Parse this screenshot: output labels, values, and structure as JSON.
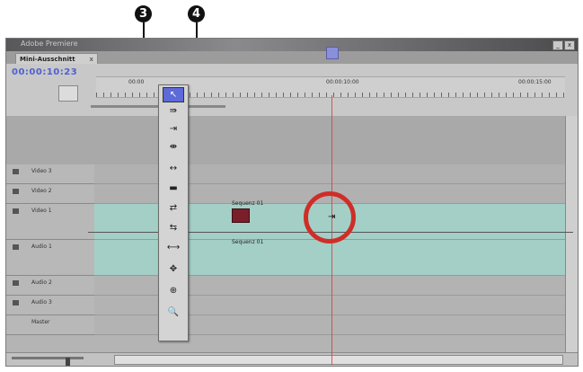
{
  "callouts": [
    "3",
    "4"
  ],
  "window": {
    "title": "Adobe Premiere",
    "minimize": "_",
    "close": "x"
  },
  "tabs": [
    {
      "label": "Mini-Ausschnitt",
      "close": "x"
    }
  ],
  "header": {
    "timecode": "00:00:10:23"
  },
  "ruler": {
    "ticks": [
      "00:00",
      "00:00:10:00",
      "00:00:15:00"
    ]
  },
  "tracks": [
    {
      "name": "Video 3",
      "kind": "video"
    },
    {
      "name": "Video 2",
      "kind": "video"
    },
    {
      "name": "Video 1",
      "kind": "teal"
    },
    {
      "name": "Audio 1",
      "kind": "teal"
    },
    {
      "name": "Audio 2",
      "kind": "audio"
    },
    {
      "name": "Audio 3",
      "kind": "audio"
    },
    {
      "name": "Master",
      "kind": "audio"
    }
  ],
  "clips": {
    "video_label": "Sequenz 01",
    "audio_label": "Sequenz 01"
  },
  "tools": [
    {
      "name": "select-tool",
      "glyph": "↖",
      "active": true
    },
    {
      "name": "track-select-tool",
      "glyph": "⇛"
    },
    {
      "name": "ripple-edit-tool",
      "glyph": "⇥"
    },
    {
      "name": "rolling-edit-tool",
      "glyph": "⇼"
    },
    {
      "name": "rate-stretch-tool",
      "glyph": "↔"
    },
    {
      "name": "razor-tool",
      "glyph": "▬"
    },
    {
      "name": "slip-tool",
      "glyph": "⇄"
    },
    {
      "name": "slide-tool",
      "glyph": "⇆"
    },
    {
      "name": "pen-tool",
      "glyph": "⟷"
    },
    {
      "name": "hand-tool",
      "glyph": "✥"
    },
    {
      "name": "zoom-tool",
      "glyph": "⊕"
    },
    {
      "name": "zoom-magnify-tool",
      "glyph": "🔍"
    }
  ],
  "colors": {
    "accent": "#5d6ad8",
    "highlight_circle": "#cf2e28",
    "teal_track": "#a3cfc6"
  }
}
